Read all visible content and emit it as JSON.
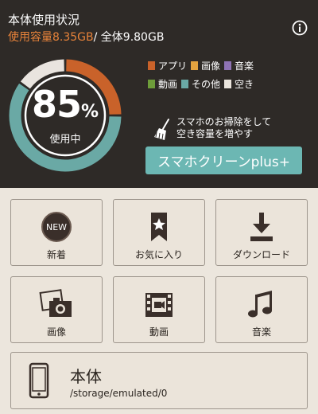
{
  "header": {
    "title": "本体使用状況",
    "used_text": "使用容量8.35GB",
    "separator": "/",
    "total_text": "全体9.80GB"
  },
  "usage_ring": {
    "percent": "85",
    "unit": "%",
    "label": "使用中",
    "segments": [
      {
        "name": "アプリ",
        "fraction": 0.25,
        "color": "#c9622a"
      },
      {
        "name": "その他",
        "fraction": 0.6,
        "color": "#6aa9a5"
      },
      {
        "name": "空き",
        "fraction": 0.15,
        "color": "#e9e4df"
      }
    ]
  },
  "legend": [
    {
      "label": "アプリ",
      "color": "#c9622a"
    },
    {
      "label": "画像",
      "color": "#e3a33f"
    },
    {
      "label": "音楽",
      "color": "#8e72b3"
    },
    {
      "label": "動画",
      "color": "#6e9d3a"
    },
    {
      "label": "その他",
      "color": "#6aa9a5"
    },
    {
      "label": "空き",
      "color": "#ebe5dd"
    }
  ],
  "cleaner": {
    "message_line1": "スマホのお掃除をして",
    "message_line2": "空き容量を増やす",
    "button_label": "スマホクリーンplus+",
    "button_color": "#6cb7b3"
  },
  "categories": [
    {
      "label": "新着",
      "icon": "new-badge-icon",
      "badge_text": "NEW"
    },
    {
      "label": "お気に入り",
      "icon": "bookmark-star-icon"
    },
    {
      "label": "ダウンロード",
      "icon": "download-icon"
    },
    {
      "label": "画像",
      "icon": "photo-camera-icon"
    },
    {
      "label": "動画",
      "icon": "film-icon"
    },
    {
      "label": "音楽",
      "icon": "music-note-icon"
    }
  ],
  "storage": {
    "name": "本体",
    "path": "/storage/emulated/0",
    "icon": "phone-icon"
  }
}
